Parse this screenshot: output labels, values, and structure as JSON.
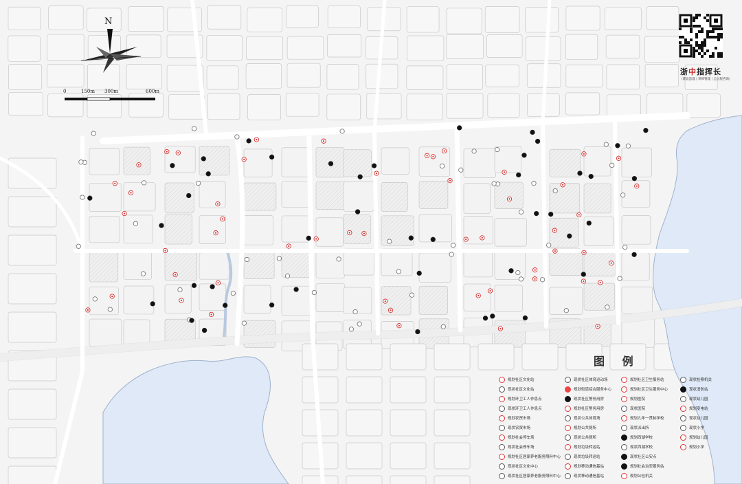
{
  "north_label": "N",
  "scale_bar": {
    "labels": [
      "0",
      "150m",
      "300m",
      "600m"
    ]
  },
  "brand": {
    "name_left": "浙",
    "name_highlight": "中",
    "name_right": "指挥长",
    "subtitle": "(建设监理 | 项目管理 | 全过程咨询)"
  },
  "legend": {
    "title": "图 例",
    "items": [
      {
        "label": "规划社区文化站",
        "style": "planned"
      },
      {
        "label": "现状社区文化站",
        "style": "existing"
      },
      {
        "label": "规划环卫工人作息点",
        "style": "planned"
      },
      {
        "label": "现状环卫工人作息点",
        "style": "existing"
      },
      {
        "label": "规划农贸市场",
        "style": "planned"
      },
      {
        "label": "现状农贸市场",
        "style": "existing"
      },
      {
        "label": "规划社会停车场",
        "style": "planned"
      },
      {
        "label": "现状社会停车场",
        "style": "existing"
      },
      {
        "label": "规划社区居家养老服务照料中心",
        "style": "planned"
      },
      {
        "label": "现状社区文化中心",
        "style": "existing"
      },
      {
        "label": "现状社区居家养老服务照料中心",
        "style": "existing"
      },
      {
        "label": "现状社区体育运动场",
        "style": "existing"
      },
      {
        "label": "规划街道综合服务中心",
        "style": "redfill"
      },
      {
        "label": "现状社区警务用房",
        "style": "filled"
      },
      {
        "label": "规划社区警务用房",
        "style": "planned"
      },
      {
        "label": "现状公共体育场",
        "style": "existing"
      },
      {
        "label": "规划公共厕所",
        "style": "planned"
      },
      {
        "label": "现状公共厕所",
        "style": "existing"
      },
      {
        "label": "规划垃圾转运站",
        "style": "planned"
      },
      {
        "label": "现状垃圾转运站",
        "style": "existing"
      },
      {
        "label": "规划移动通信基站",
        "style": "planned"
      },
      {
        "label": "现状移动通信基站",
        "style": "existing"
      },
      {
        "label": "规划社区卫生服务站",
        "style": "planned"
      },
      {
        "label": "规划社区卫生服务中心",
        "style": "planned"
      },
      {
        "label": "规划医院",
        "style": "planned"
      },
      {
        "label": "现状医院",
        "style": "existing"
      },
      {
        "label": "规划九年一贯制学校",
        "style": "planned"
      },
      {
        "label": "现状派出所",
        "style": "existing"
      },
      {
        "label": "规划西湖学校",
        "style": "filled"
      },
      {
        "label": "现状西湖学校",
        "style": "existing"
      },
      {
        "label": "现状社区公安点",
        "style": "filled"
      },
      {
        "label": "规划社会治安服务站",
        "style": "filled"
      },
      {
        "label": "规划公检机关",
        "style": "planned"
      },
      {
        "label": "现状检察机关",
        "style": "existing"
      },
      {
        "label": "现状消防站",
        "style": "filled"
      },
      {
        "label": "现状幼儿园",
        "style": "existing"
      },
      {
        "label": "规划变电站",
        "style": "planned"
      },
      {
        "label": "现状幼儿园",
        "style": "existing"
      },
      {
        "label": "现状小学",
        "style": "existing"
      },
      {
        "label": "规划幼儿园",
        "style": "planned"
      },
      {
        "label": "规划小学",
        "style": "planned"
      }
    ]
  },
  "colors": {
    "water": "#dfe9f7",
    "road_fill": "#ffffff",
    "block_fill": "#f1f1f1",
    "block_stroke": "#c8c8c8",
    "planned_marker": "#d32f2f",
    "existing_marker": "#222222"
  }
}
